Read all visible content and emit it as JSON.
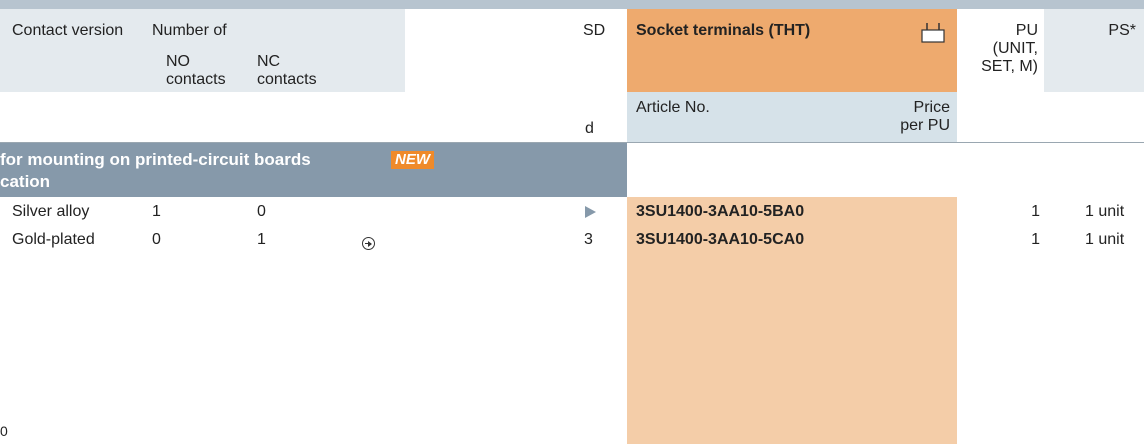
{
  "header": {
    "contact_version": "Contact version",
    "number_of": "Number of",
    "no_contacts_1": "NO",
    "no_contacts_2": "contacts",
    "nc_contacts_1": "NC",
    "nc_contacts_2": "contacts",
    "sd": "SD",
    "sd_unit": "d",
    "socket_title": "Socket terminals (THT)",
    "socket_icon": "socket-terminal-icon",
    "article_no": "Article No.",
    "price_1": "Price",
    "price_2": "per PU",
    "pu_1": "PU",
    "pu_2": "(UNIT,",
    "pu_3": "SET, M)",
    "ps": "PS*"
  },
  "section": {
    "title_line1": "for mounting on printed-circuit boards",
    "badge": "NEW",
    "title_line2": "cation"
  },
  "rows": [
    {
      "contact_version": "Silver alloy",
      "no": "1",
      "nc": "0",
      "icon": "",
      "sd": "play-icon",
      "article": "3SU1400-3AA10-5BA0",
      "pu": "1",
      "ps": "1 unit"
    },
    {
      "contact_version": "Gold-plated",
      "no": "0",
      "nc": "1",
      "icon": "circle-arrow-icon",
      "sd": "3",
      "article": "3SU1400-3AA10-5CA0",
      "pu": "1",
      "ps": "1 unit"
    }
  ],
  "footer": {
    "page_fragment": "0"
  },
  "colors": {
    "header_bg": "#e4eaee",
    "socket_header": "#eeaa6e",
    "socket_body": "#f4cda8",
    "section_bar": "#8699aa",
    "new_badge": "#ef8a2a"
  }
}
